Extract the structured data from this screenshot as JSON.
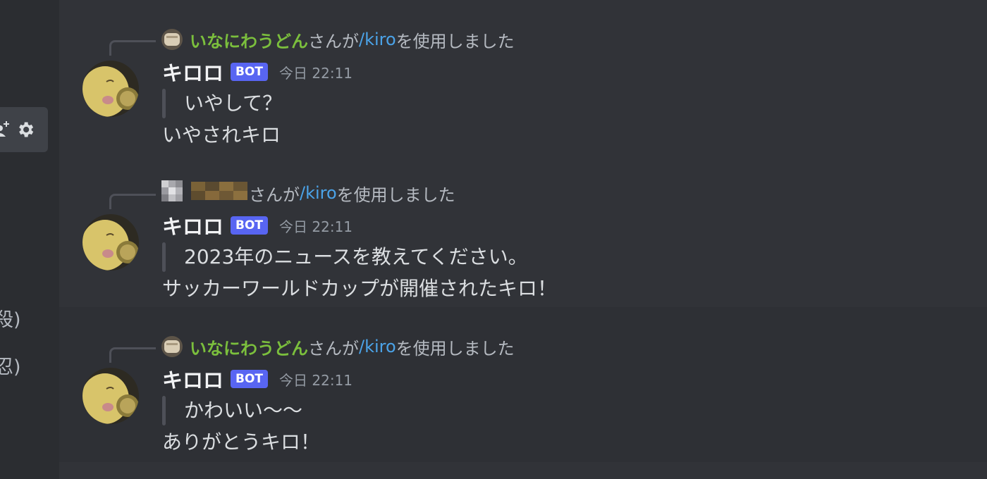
{
  "sidebar": {
    "fragments": [
      "殺)",
      "忍)"
    ],
    "icons": [
      "add-member-icon",
      "gear-icon"
    ]
  },
  "messages": [
    {
      "invoker": {
        "name": "いなにわうどん",
        "suffix": "さんが",
        "command": "/kiro",
        "action": "を使用しました",
        "avatar": "bread-avatar"
      },
      "author": "キロロ",
      "badge": "BOT",
      "time": "今日 22:11",
      "quote": "いやして？",
      "reply": "いやされキロ"
    },
    {
      "invoker": {
        "name": "",
        "suffix": "さんが",
        "command": "/kiro",
        "action": "を使用しました",
        "avatar": "pixelated-avatar",
        "redacted": true
      },
      "author": "キロロ",
      "badge": "BOT",
      "time": "今日 22:11",
      "quote": "2023年のニュースを教えてください。",
      "reply": "サッカーワールドカップが開催されたキロ！"
    },
    {
      "invoker": {
        "name": "いなにわうどん",
        "suffix": "さんが",
        "command": "/kiro",
        "action": "を使用しました",
        "avatar": "bread-avatar"
      },
      "author": "キロロ",
      "badge": "BOT",
      "time": "今日 22:11",
      "quote": "かわいい〜〜",
      "reply": "ありがとうキロ！"
    }
  ],
  "colors": {
    "background": "#313338",
    "sidebar": "#2b2d31",
    "invoker_name": "#7bbf3d",
    "command_link": "#4ba3e8",
    "bot_badge": "#5865f2"
  }
}
